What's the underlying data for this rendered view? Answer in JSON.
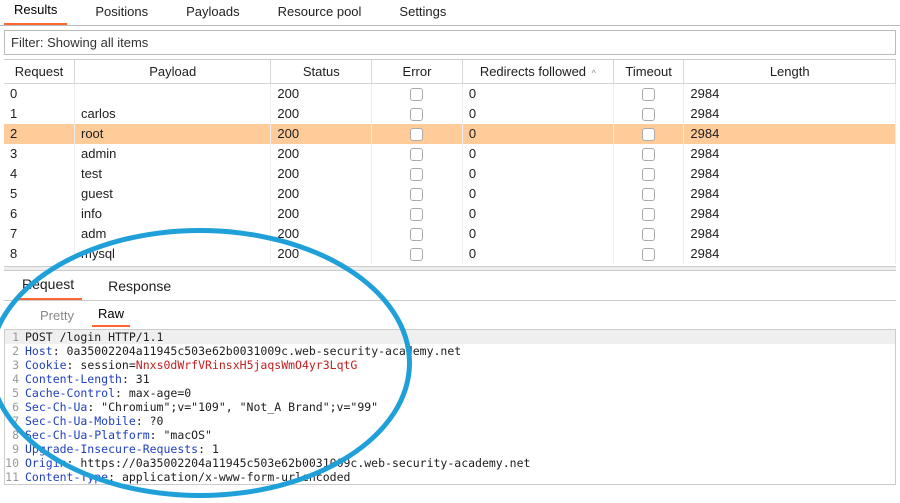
{
  "top_tabs": {
    "results": "Results",
    "positions": "Positions",
    "payloads": "Payloads",
    "resource_pool": "Resource pool",
    "settings": "Settings",
    "active": "results"
  },
  "filter_text": "Filter: Showing all items",
  "columns": {
    "request": "Request",
    "payload": "Payload",
    "status": "Status",
    "error": "Error",
    "redirects": "Redirects followed",
    "timeout": "Timeout",
    "length": "Length",
    "sort_asc_glyph": "^"
  },
  "rows": [
    {
      "request": "0",
      "payload": "",
      "status": "200",
      "redirects": "0",
      "length": "2984",
      "selected": false
    },
    {
      "request": "1",
      "payload": "carlos",
      "status": "200",
      "redirects": "0",
      "length": "2984",
      "selected": false
    },
    {
      "request": "2",
      "payload": "root",
      "status": "200",
      "redirects": "0",
      "length": "2984",
      "selected": true
    },
    {
      "request": "3",
      "payload": "admin",
      "status": "200",
      "redirects": "0",
      "length": "2984",
      "selected": false
    },
    {
      "request": "4",
      "payload": "test",
      "status": "200",
      "redirects": "0",
      "length": "2984",
      "selected": false
    },
    {
      "request": "5",
      "payload": "guest",
      "status": "200",
      "redirects": "0",
      "length": "2984",
      "selected": false
    },
    {
      "request": "6",
      "payload": "info",
      "status": "200",
      "redirects": "0",
      "length": "2984",
      "selected": false
    },
    {
      "request": "7",
      "payload": "adm",
      "status": "200",
      "redirects": "0",
      "length": "2984",
      "selected": false
    },
    {
      "request": "8",
      "payload": "mysql",
      "status": "200",
      "redirects": "0",
      "length": "2984",
      "selected": false
    }
  ],
  "mid_tabs": {
    "request": "Request",
    "response": "Response",
    "active": "request"
  },
  "view_tabs": {
    "pretty": "Pretty",
    "raw": "Raw",
    "active": "raw"
  },
  "raw_lines": [
    {
      "n": "1",
      "hl": true,
      "segs": [
        {
          "t": "POST /login HTTP/1.1",
          "c": ""
        }
      ]
    },
    {
      "n": "2",
      "hl": false,
      "segs": [
        {
          "t": "Host",
          "c": "hdr-key"
        },
        {
          "t": ": 0a35002204a11945c503e62b0031009c.web-security-academy.net",
          "c": ""
        }
      ]
    },
    {
      "n": "3",
      "hl": false,
      "segs": [
        {
          "t": "Cookie",
          "c": "hdr-key"
        },
        {
          "t": ": session=",
          "c": ""
        },
        {
          "t": "Nnxs0dWrfVRinsxH5jaqsWmO4yr3LqtG",
          "c": "hdr-cookie-val"
        }
      ]
    },
    {
      "n": "4",
      "hl": false,
      "segs": [
        {
          "t": "Content-Length",
          "c": "hdr-key"
        },
        {
          "t": ": 31",
          "c": ""
        }
      ]
    },
    {
      "n": "5",
      "hl": false,
      "segs": [
        {
          "t": "Cache-Control",
          "c": "hdr-key"
        },
        {
          "t": ": max-age=0",
          "c": ""
        }
      ]
    },
    {
      "n": "6",
      "hl": false,
      "segs": [
        {
          "t": "Sec-Ch-Ua",
          "c": "hdr-key"
        },
        {
          "t": ": \"Chromium\";v=\"109\", \"Not_A Brand\";v=\"99\"",
          "c": ""
        }
      ]
    },
    {
      "n": "7",
      "hl": false,
      "segs": [
        {
          "t": "Sec-Ch-Ua-Mobile",
          "c": "hdr-key"
        },
        {
          "t": ": ?0",
          "c": ""
        }
      ]
    },
    {
      "n": "8",
      "hl": false,
      "segs": [
        {
          "t": "Sec-Ch-Ua-Platform",
          "c": "hdr-key"
        },
        {
          "t": ": \"macOS\"",
          "c": ""
        }
      ]
    },
    {
      "n": "9",
      "hl": false,
      "segs": [
        {
          "t": "Upgrade-Insecure-Requests",
          "c": "hdr-key"
        },
        {
          "t": ": 1",
          "c": ""
        }
      ]
    },
    {
      "n": "10",
      "hl": false,
      "segs": [
        {
          "t": "Origin",
          "c": "hdr-key"
        },
        {
          "t": ": https://0a35002204a11945c503e62b0031009c.web-security-academy.net",
          "c": ""
        }
      ]
    },
    {
      "n": "11",
      "hl": false,
      "segs": [
        {
          "t": "Content-Type",
          "c": "hdr-key"
        },
        {
          "t": ": application/x-www-form-urlencoded",
          "c": ""
        }
      ]
    }
  ]
}
